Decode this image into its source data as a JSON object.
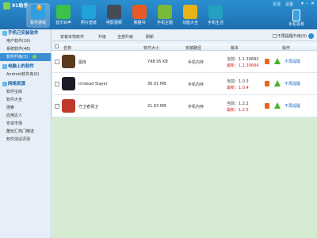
{
  "app": {
    "logo_text": "91助手"
  },
  "nav": [
    {
      "label": "软件游戏",
      "color": "#2f9fe3",
      "badge": "8",
      "active": true
    },
    {
      "label": "音乐铃声",
      "color": "#3cc24a"
    },
    {
      "label": "照片壁纸",
      "color": "#1ea2d9"
    },
    {
      "label": "电影视频",
      "color": "#444c57"
    },
    {
      "label": "熊猫书",
      "color": "#e65a25"
    },
    {
      "label": "手机主题",
      "color": "#7ab83a"
    },
    {
      "label": "功能大全",
      "color": "#e7b316"
    },
    {
      "label": "手机生活",
      "color": "#23a0c0"
    }
  ],
  "window": {
    "links": [
      "反馈",
      "设置"
    ],
    "buttons": [
      "▾",
      "–",
      "✕"
    ]
  },
  "device": {
    "label": "手机名称"
  },
  "sidebar": {
    "sections": [
      {
        "title": "手机已安装软件",
        "items": [
          "用户软件(16)",
          "系统软件(48)",
          "软件升级(3)"
        ],
        "selected": 2
      },
      {
        "title": "电脑上的软件",
        "items": [
          "Android软件库(0)"
        ]
      },
      {
        "title": "网络资源",
        "items": [
          "软件宝库",
          "软件大全",
          "搜索",
          "应用达人",
          "安卓市场",
          "酷玩汇热门精选",
          "软件测试评测"
        ]
      }
    ]
  },
  "toolbar": {
    "tabs": [
      "安装本地软件",
      "升级",
      "全部升级",
      "刷新"
    ],
    "ignored_label": "不再提醒升级(0)"
  },
  "table": {
    "headers": [
      "名称",
      "软件大小",
      "安装路径",
      "版本",
      "操作"
    ],
    "rows": [
      {
        "name": "图库",
        "size": "748.95 KB",
        "path": "手机内存",
        "current": "当前：1.1.30682",
        "latest": "最新：1.1.30684",
        "action": "不再提醒",
        "icon_color": "#5a3a1e"
      },
      {
        "name": "Undead Slayer",
        "size": "36.01 MB",
        "path": "手机内存",
        "current": "当前：1.0.3",
        "latest": "最新：1.0.4",
        "action": "不再提醒",
        "icon_color": "#1b1b28"
      },
      {
        "name": "守卫者保卫",
        "size": "21.63 MB",
        "path": "手机内存",
        "current": "当前：1.2.2",
        "latest": "最新：1.2.5",
        "action": "不再提醒",
        "icon_color": "#c0392b"
      }
    ]
  }
}
